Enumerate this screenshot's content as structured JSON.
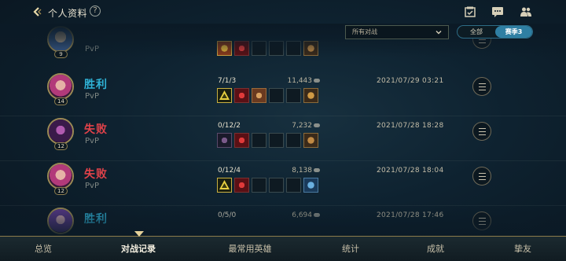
{
  "header": {
    "title": "个人资料",
    "help_label": "?"
  },
  "filter": {
    "mode_selected": "所有对战",
    "seg_all": "全部",
    "seg_season": "赛季3"
  },
  "colors": {
    "win": "#2fb2d6",
    "loss": "#e0424a",
    "accent": "#2f7fa3"
  },
  "matches": [
    {
      "result": "",
      "mode": "PvP",
      "level": "9",
      "kda": "",
      "gold": "",
      "date": "",
      "champion": "blue-haired",
      "items": [
        "gold-item",
        "crimson-item",
        "empty",
        "empty",
        "empty",
        "trinket"
      ]
    },
    {
      "result": "胜利",
      "mode": "PvP",
      "level": "14",
      "kda": "7/1/3",
      "gold": "11,443",
      "date": "2021/07/29 03:21",
      "champion": "pink-haired",
      "items": [
        "gold-triangle-item",
        "crimson-item",
        "bronze-item",
        "empty",
        "empty",
        "trinket"
      ]
    },
    {
      "result": "失败",
      "mode": "PvP",
      "level": "12",
      "kda": "0/12/2",
      "gold": "7,232",
      "date": "2021/07/28 18:28",
      "champion": "dark-purple",
      "items": [
        "dark-item",
        "crimson-item",
        "empty",
        "empty",
        "empty",
        "trinket"
      ]
    },
    {
      "result": "失败",
      "mode": "PvP",
      "level": "12",
      "kda": "0/12/4",
      "gold": "8,138",
      "date": "2021/07/28 18:04",
      "champion": "pink-haired",
      "items": [
        "gold-triangle-item",
        "crimson-item",
        "empty",
        "empty",
        "empty",
        "blue-trinket"
      ]
    },
    {
      "result": "胜利",
      "mode": "",
      "level": "",
      "kda": "0/5/0",
      "gold": "6,694",
      "date": "2021/07/28 17:46",
      "champion": "purple-haired",
      "items": [
        "empty",
        "empty",
        "empty",
        "empty",
        "empty",
        "empty"
      ]
    }
  ],
  "nav": {
    "tabs": [
      "总览",
      "对战记录",
      "最常用英雄",
      "统计",
      "成就",
      "挚友"
    ],
    "active_index": 1
  }
}
